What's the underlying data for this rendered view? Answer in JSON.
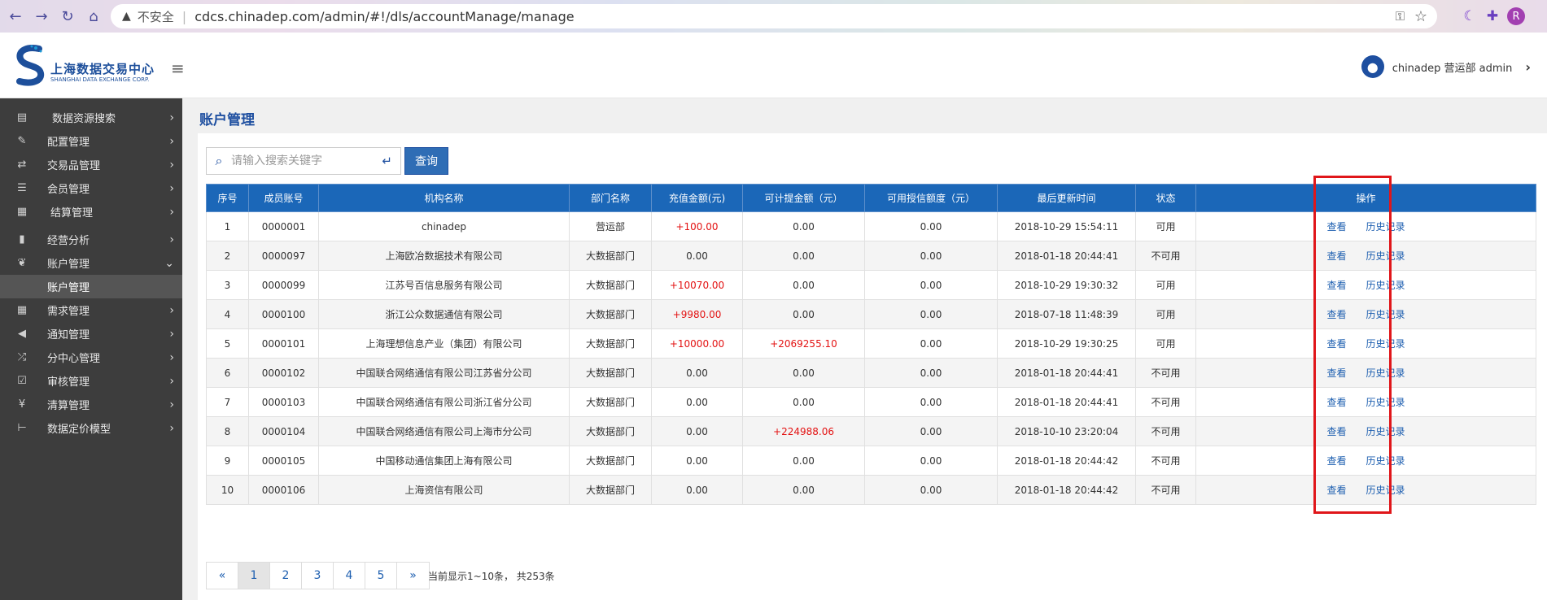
{
  "browser": {
    "security": "不安全",
    "url": "cdcs.chinadep.com/admin/#!/dls/accountManage/manage",
    "profile_initial": "R"
  },
  "header": {
    "logo_cn": "上海数据交易中心",
    "logo_en": "SHANGHAI DATA EXCHANGE CORP.",
    "user": "chinadep 营运部 admin"
  },
  "sidebar": {
    "items": [
      {
        "label": "数据资源搜索",
        "icon": "window-icon"
      },
      {
        "label": "配置管理",
        "icon": "wrench-icon"
      },
      {
        "label": "交易品管理",
        "icon": "exchange-icon"
      },
      {
        "label": "会员管理",
        "icon": "list-icon"
      },
      {
        "label": "结算管理",
        "icon": "calculator-icon"
      },
      {
        "label": "经营分析",
        "icon": "bar-chart-icon"
      },
      {
        "label": "账户管理",
        "icon": "leaf-icon"
      },
      {
        "label": "账户管理",
        "icon": ""
      },
      {
        "label": "需求管理",
        "icon": "grid-icon"
      },
      {
        "label": "通知管理",
        "icon": "megaphone-icon"
      },
      {
        "label": "分中心管理",
        "icon": "shuffle-icon"
      },
      {
        "label": "审核管理",
        "icon": "check-icon"
      },
      {
        "label": "清算管理",
        "icon": "yen-icon"
      },
      {
        "label": "数据定价模型",
        "icon": "tree-icon"
      }
    ]
  },
  "page": {
    "title": "账户管理",
    "search_placeholder": "请输入搜索关键字",
    "query_label": "查询"
  },
  "table": {
    "headers": [
      "序号",
      "成员账号",
      "机构名称",
      "部门名称",
      "充值金额(元)",
      "可计提金额（元）",
      "可用授信额度（元）",
      "最后更新时间",
      "状态",
      "操作"
    ],
    "rows": [
      [
        "1",
        "0000001",
        "chinadep",
        "营运部",
        "+100.00",
        "0.00",
        "0.00",
        "2018-10-29 15:54:11",
        "可用"
      ],
      [
        "2",
        "0000097",
        "上海欧冶数据技术有限公司",
        "大数据部门",
        "0.00",
        "0.00",
        "0.00",
        "2018-01-18 20:44:41",
        "不可用"
      ],
      [
        "3",
        "0000099",
        "江苏号百信息服务有限公司",
        "大数据部门",
        "+10070.00",
        "0.00",
        "0.00",
        "2018-10-29 19:30:32",
        "可用"
      ],
      [
        "4",
        "0000100",
        "浙江公众数据通信有限公司",
        "大数据部门",
        "+9980.00",
        "0.00",
        "0.00",
        "2018-07-18 11:48:39",
        "可用"
      ],
      [
        "5",
        "0000101",
        "上海理想信息产业（集团）有限公司",
        "大数据部门",
        "+10000.00",
        "+2069255.10",
        "0.00",
        "2018-10-29 19:30:25",
        "可用"
      ],
      [
        "6",
        "0000102",
        "中国联合网络通信有限公司江苏省分公司",
        "大数据部门",
        "0.00",
        "0.00",
        "0.00",
        "2018-01-18 20:44:41",
        "不可用"
      ],
      [
        "7",
        "0000103",
        "中国联合网络通信有限公司浙江省分公司",
        "大数据部门",
        "0.00",
        "0.00",
        "0.00",
        "2018-01-18 20:44:41",
        "不可用"
      ],
      [
        "8",
        "0000104",
        "中国联合网络通信有限公司上海市分公司",
        "大数据部门",
        "0.00",
        "+224988.06",
        "0.00",
        "2018-10-10 23:20:04",
        "不可用"
      ],
      [
        "9",
        "0000105",
        "中国移动通信集团上海有限公司",
        "大数据部门",
        "0.00",
        "0.00",
        "0.00",
        "2018-01-18 20:44:42",
        "不可用"
      ],
      [
        "10",
        "0000106",
        "上海资信有限公司",
        "大数据部门",
        "0.00",
        "0.00",
        "0.00",
        "2018-01-18 20:44:42",
        "不可用"
      ]
    ],
    "action_view": "查看",
    "action_history": "历史记录"
  },
  "pagination": {
    "prev": "«",
    "pages": [
      "1",
      "2",
      "3",
      "4",
      "5"
    ],
    "next": "»",
    "current": "1",
    "info": "当前显示1~10条， 共253条"
  }
}
